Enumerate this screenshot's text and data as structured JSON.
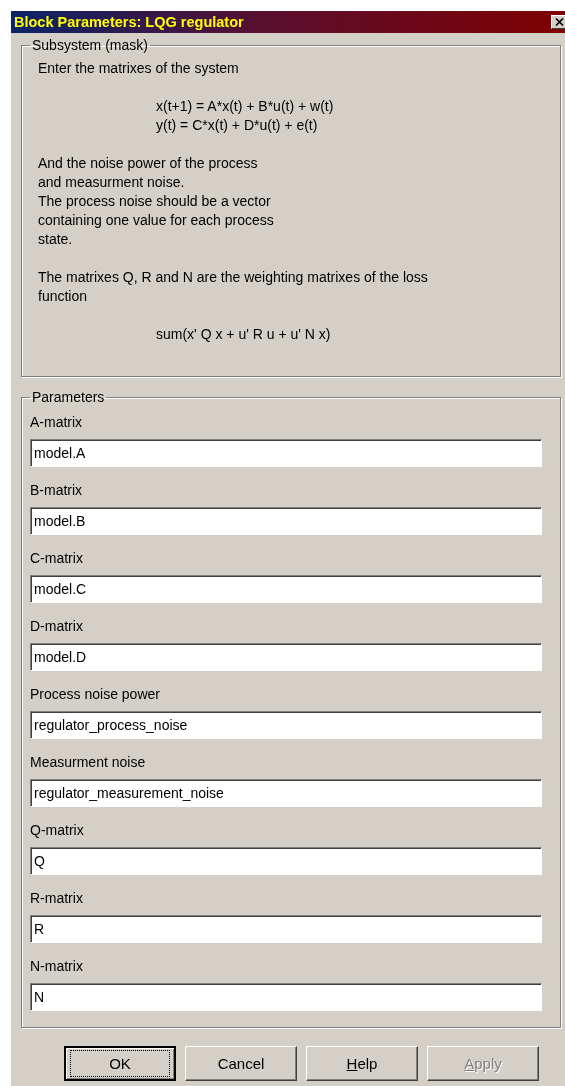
{
  "window": {
    "title": "Block Parameters: LQG regulator"
  },
  "description_group": {
    "legend": "Subsystem (mask)",
    "paragraphs": [
      {
        "kind": "text",
        "lines": [
          "Enter the matrixes of the system"
        ]
      },
      {
        "kind": "formula",
        "lines": [
          "x(t+1) = A*x(t) + B*u(t) + w(t)",
          "y(t) = C*x(t) + D*u(t) + e(t)"
        ]
      },
      {
        "kind": "text",
        "lines": [
          "And the noise power of the process",
          "and measurment noise.",
          "The process noise should be a vector",
          "containing one value for each process",
          "state."
        ]
      },
      {
        "kind": "text",
        "lines": [
          "The matrixes Q, R and N are the weighting matrixes of the loss",
          "function"
        ]
      },
      {
        "kind": "formula",
        "lines": [
          "sum(x' Q x + u' R u + u' N x)"
        ]
      }
    ]
  },
  "parameters_group": {
    "legend": "Parameters",
    "fields": [
      {
        "label": "A-matrix",
        "value": "model.A"
      },
      {
        "label": "B-matrix",
        "value": "model.B"
      },
      {
        "label": "C-matrix",
        "value": "model.C"
      },
      {
        "label": "D-matrix",
        "value": "model.D"
      },
      {
        "label": "Process noise power",
        "value": "regulator_process_noise"
      },
      {
        "label": "Measurment noise",
        "value": "regulator_measurement_noise"
      },
      {
        "label": "Q-matrix",
        "value": "Q"
      },
      {
        "label": "R-matrix",
        "value": "R"
      },
      {
        "label": "N-matrix",
        "value": "N"
      }
    ]
  },
  "buttons": [
    {
      "label": "OK",
      "default": true,
      "disabled": false
    },
    {
      "label": "Cancel",
      "default": false,
      "disabled": false
    },
    {
      "label": "Help",
      "default": false,
      "disabled": false,
      "first_letter_underlined": true
    },
    {
      "label": "Apply",
      "default": false,
      "disabled": true,
      "first_letter_underlined": true
    }
  ]
}
